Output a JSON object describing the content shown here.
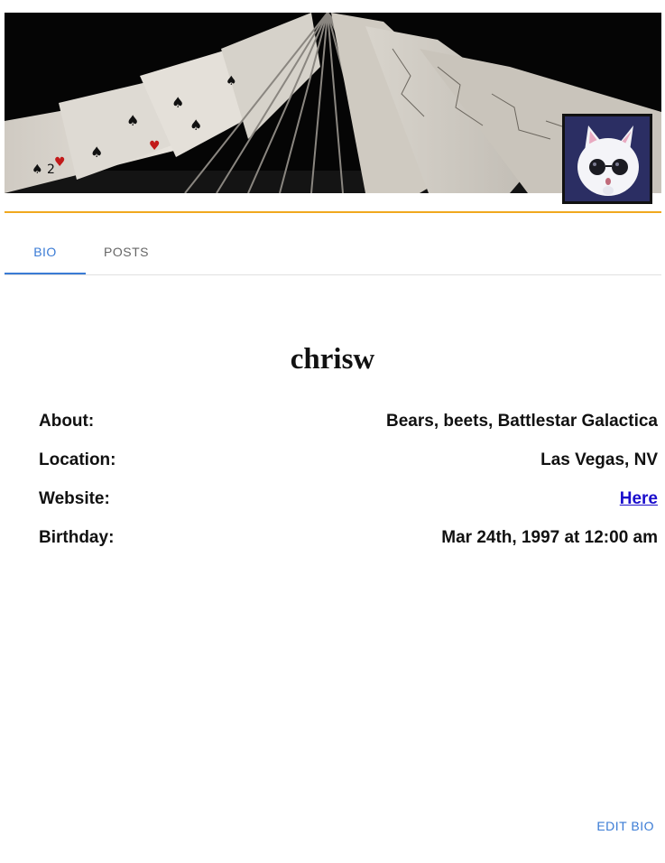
{
  "profile": {
    "username": "chrisw",
    "avatar_icon": "cat-with-sunglasses-avatar",
    "banner_image": "playing-cards-fan-photo"
  },
  "tabs": [
    {
      "label": "BIO",
      "active": true
    },
    {
      "label": "POSTS",
      "active": false
    }
  ],
  "bio": {
    "about_label": "About:",
    "about_value": "Bears, beets, Battlestar Galactica",
    "location_label": "Location:",
    "location_value": "Las Vegas, NV",
    "website_label": "Website:",
    "website_value": "Here",
    "birthday_label": "Birthday:",
    "birthday_value": "Mar 24th, 1997 at 12:00 am"
  },
  "actions": {
    "edit_bio_label": "EDIT BIO"
  },
  "colors": {
    "accent": "#3a7bd5",
    "divider": "#f0a81e",
    "link": "#1a0dcc"
  }
}
